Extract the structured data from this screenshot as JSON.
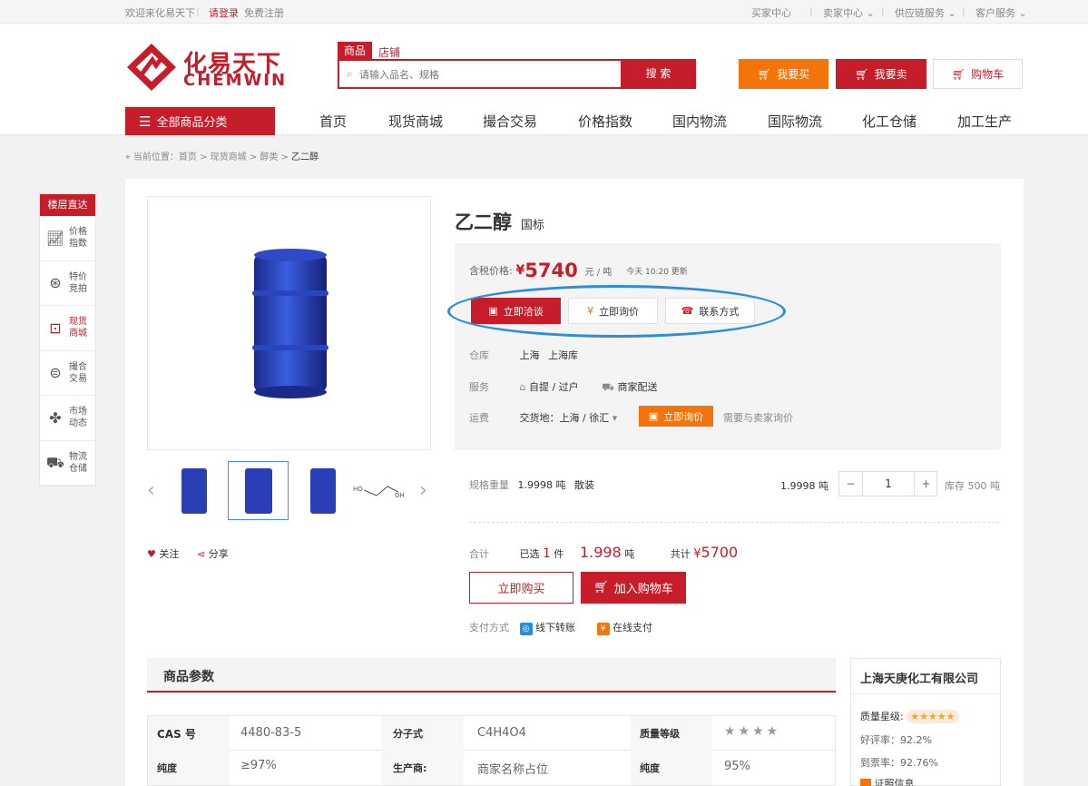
{
  "topbar": {
    "welcome": "欢迎来化易天下",
    "login": "请登录",
    "register": "免费注册",
    "buyer": "买家中心",
    "seller": "卖家中心",
    "supply": "供应链服务",
    "service": "客户服务"
  },
  "logo": {
    "cn": "化易天下",
    "en": "CHEMWIN"
  },
  "search": {
    "tab_goods": "商品",
    "tab_shop": "店铺",
    "placeholder": "请输入品名、规格",
    "button": "搜 索"
  },
  "header_buttons": {
    "buy": "我要买",
    "sell": "我要卖",
    "cart": "购物车"
  },
  "nav": {
    "all": "全部商品分类",
    "items": [
      "首页",
      "现货商城",
      "撮合交易",
      "价格指数",
      "国内物流",
      "国际物流",
      "化工仓储",
      "加工生产"
    ]
  },
  "breadcrumb": {
    "prefix": "当前位置：",
    "home": "首页",
    "mall": "现货商城",
    "cat": "醇类",
    "current": "乙二醇",
    "sep": ">"
  },
  "floor": {
    "title": "楼层直达",
    "items": [
      [
        "价格",
        "指数"
      ],
      [
        "特价",
        "竞拍"
      ],
      [
        "现货",
        "商城"
      ],
      [
        "撮合",
        "交易"
      ],
      [
        "市场",
        "动态"
      ],
      [
        "物流",
        "仓储"
      ]
    ]
  },
  "product": {
    "name": "乙二醇",
    "grade": "国标",
    "price_label": "含税价格:",
    "currency": "¥",
    "price": "5740",
    "unit": "元 / 吨",
    "updated": "今天 10:20 更新"
  },
  "actions": {
    "negotiate": "立即洽谈",
    "inquiry": "立即询价",
    "contact": "联系方式"
  },
  "info": {
    "warehouse_label": "仓库",
    "warehouse_city": "上海",
    "warehouse_name": "上海库",
    "service_label": "服务",
    "service_1": "自提 / 过户",
    "service_2": "商家配送",
    "freight_label": "运费",
    "delivery": "交货地：上海 / 徐汇",
    "inquiry_btn": "立即询价",
    "need": "需要与卖家询价"
  },
  "spec": {
    "label": "规格重量",
    "weight": "1.9998 吨",
    "pack": "散装",
    "unit_weight": "1.9998 吨",
    "qty": "1",
    "minus": "−",
    "plus": "+",
    "stock": "库存 500 吨"
  },
  "total": {
    "label": "合计",
    "selected": "已选",
    "count": "1",
    "piece": "件",
    "weight": "1.998",
    "ton": "吨",
    "sum_label": "共计",
    "currency": "¥",
    "sum": "5700"
  },
  "buy": {
    "buy_now": "立即购买",
    "add_cart": "加入购物车"
  },
  "payment": {
    "label": "支付方式",
    "offline": "线下转账",
    "online": "在线支付"
  },
  "social": {
    "follow": "关注",
    "share": "分享"
  },
  "thumb": {
    "formula_ho": "HO",
    "formula_oh": "OH"
  },
  "params": {
    "title": "商品参数",
    "rows": [
      [
        "CAS 号",
        "4480-83-5",
        "分子式",
        "C4H4O4",
        "质量等级",
        ""
      ],
      [
        "纯度",
        "≥97%",
        "生产商:",
        "商家名称占位",
        "纯度",
        "95%"
      ]
    ]
  },
  "company": {
    "name": "上海天庚化工有限公司",
    "quality_label": "质量星级:",
    "rating": "好评率：92.2%",
    "ticket": "到票率：92.76%",
    "license": "证照信息"
  },
  "colors": {
    "brand": "#c51e2a",
    "orange": "#f5740a",
    "highlight": "#2a8de0"
  }
}
